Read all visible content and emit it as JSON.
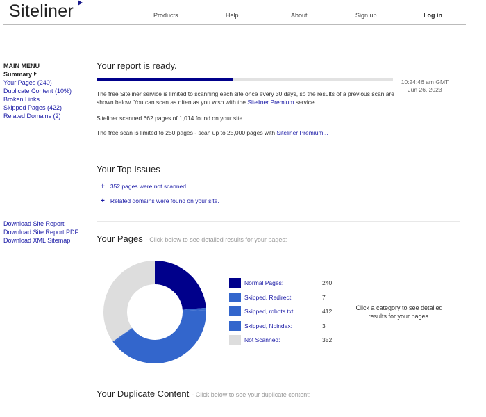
{
  "header": {
    "logo": "Siteliner",
    "nav": [
      "Products",
      "Help",
      "About",
      "Sign up"
    ],
    "login": "Log in"
  },
  "sidebar": {
    "title": "MAIN MENU",
    "summary": "Summary",
    "items": [
      {
        "label": "Your Pages (240)"
      },
      {
        "label": "Duplicate Content (10%)"
      },
      {
        "label": "Broken Links"
      },
      {
        "label": "Skipped Pages (422)"
      },
      {
        "label": "Related Domains (2)"
      }
    ],
    "downloads": [
      {
        "label": "Download Site Report"
      },
      {
        "label": "Download Site Report PDF"
      },
      {
        "label": "Download XML Sitemap"
      }
    ]
  },
  "report": {
    "title": "Your report is ready.",
    "progress": 0.46,
    "time": "10:24:46 am GMT",
    "date": "Jun 26, 2023",
    "p1_text": "The free Siteliner service is limited to scanning each site once every 30 days, so the results of a previous scan are shown below. You can scan as often as you wish with the",
    "p1_link": "Siteliner Premium",
    "p1_end": "service.",
    "p2": "Siteliner scanned 662 pages of 1,014 found on your site.",
    "p3_text": "The free scan is limited to 250 pages - scan up to 25,000 pages with",
    "p3_link": "Siteliner Premium..."
  },
  "issues": {
    "title": "Your Top Issues",
    "items": [
      {
        "label": "352 pages were not scanned."
      },
      {
        "label": "Related domains were found on your site."
      }
    ]
  },
  "pages": {
    "title": "Your Pages",
    "subtitle": "- Click below to see detailed results for your pages:",
    "hint": "Click a category to see detailed results for your pages."
  },
  "chart_data": {
    "type": "pie",
    "categories": [
      "Normal Pages:",
      "Skipped, Redirect:",
      "Skipped, robots.txt:",
      "Skipped, Noindex:",
      "Not Scanned:"
    ],
    "values": [
      240,
      7,
      412,
      3,
      352
    ],
    "colors": [
      "#00008b",
      "#3366cc",
      "#3366cc",
      "#3366cc",
      "#dddddd"
    ]
  },
  "duplicate": {
    "title": "Your Duplicate Content",
    "subtitle": "- Click below to see your duplicate content:"
  }
}
